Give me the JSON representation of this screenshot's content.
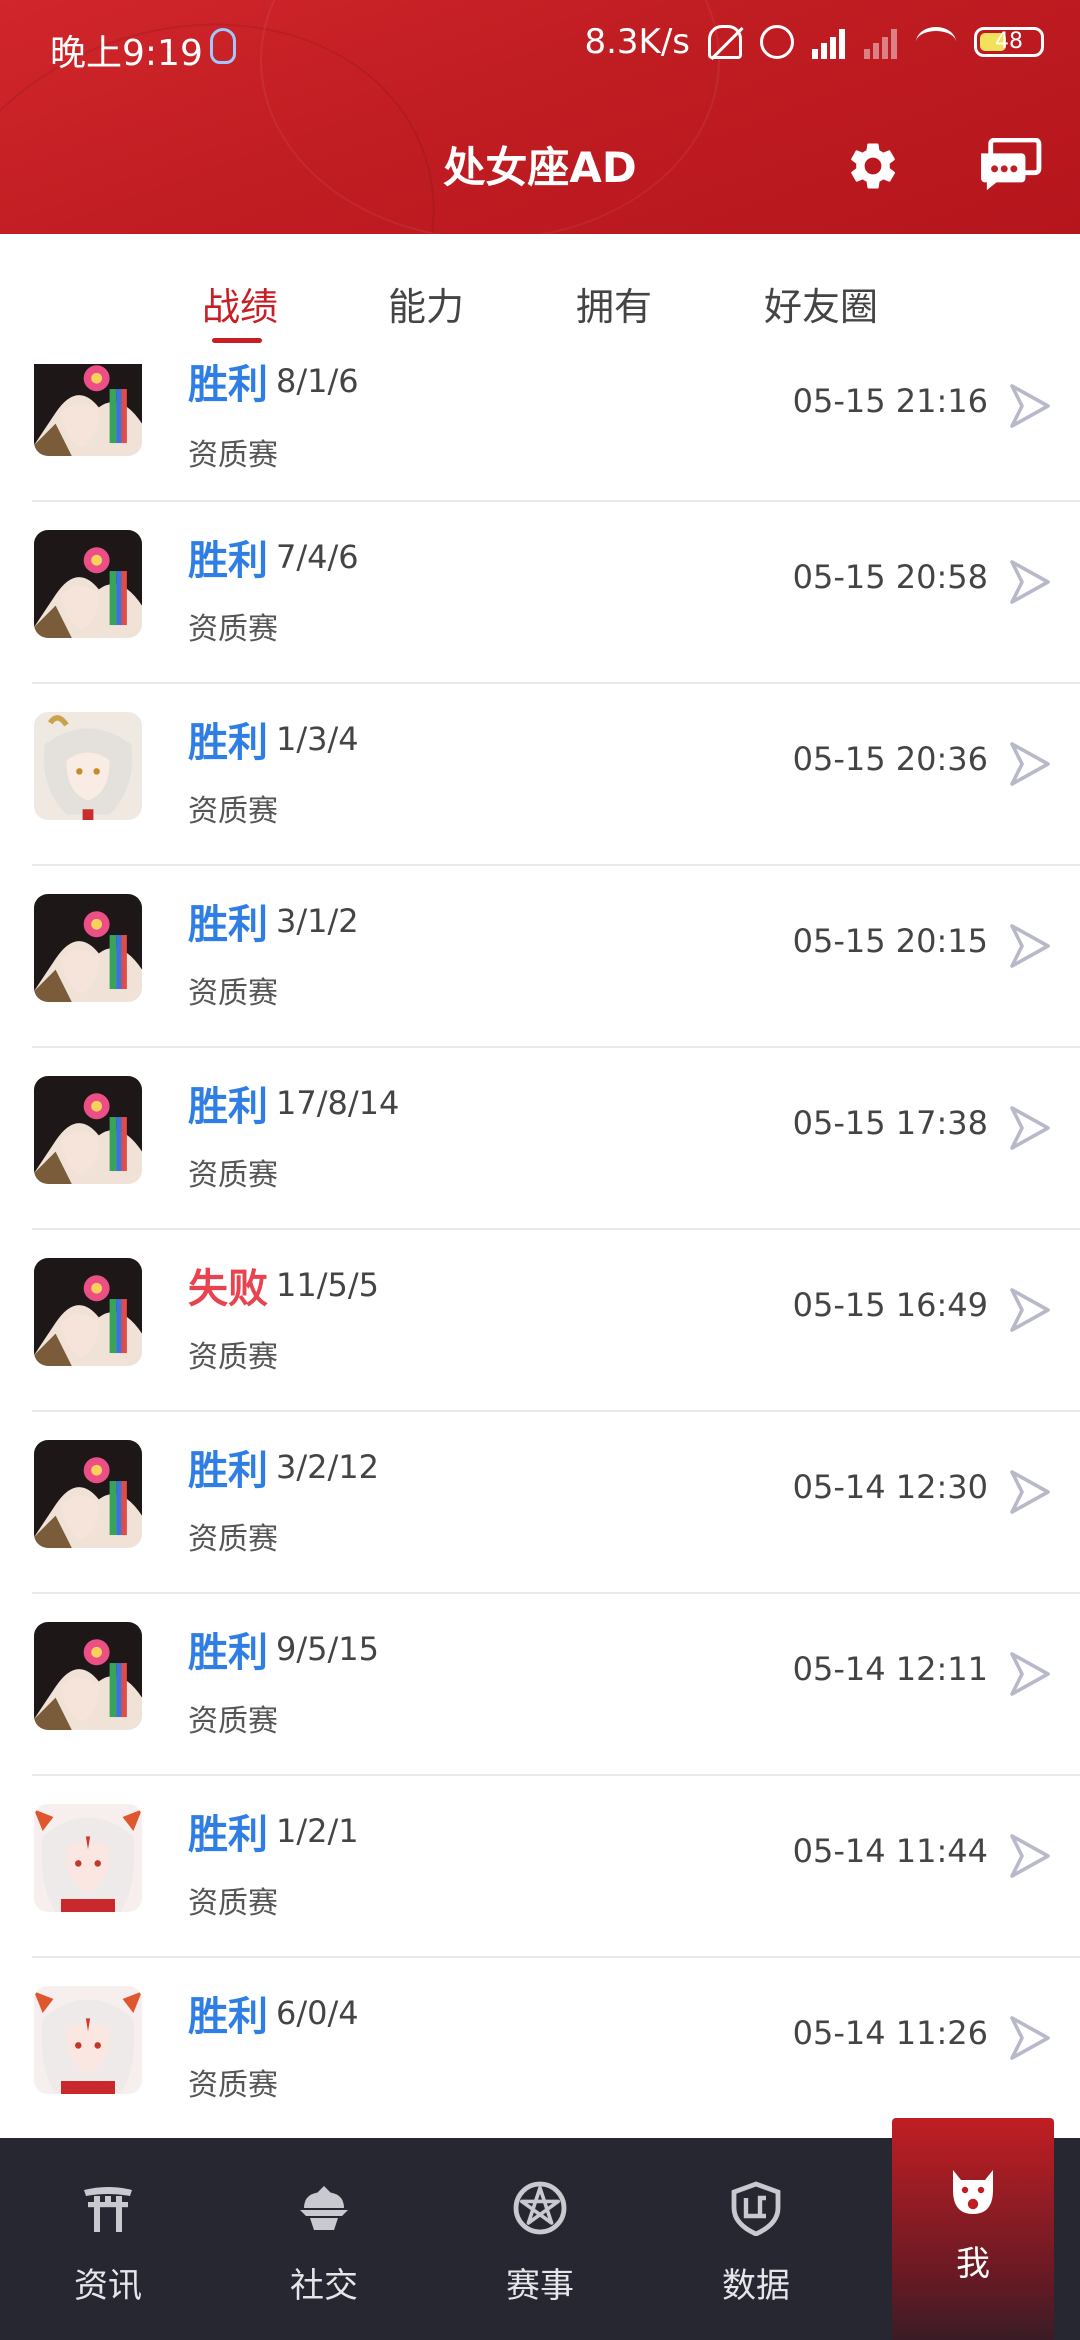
{
  "status_bar": {
    "time": "晚上9:19",
    "network_speed": "8.3K/s",
    "battery_level": "48"
  },
  "header": {
    "title": "处女座AD"
  },
  "tabs": [
    {
      "label": "战绩",
      "active": true
    },
    {
      "label": "能力",
      "active": false
    },
    {
      "label": "拥有",
      "active": false
    },
    {
      "label": "好友圈",
      "active": false
    }
  ],
  "matches": [
    {
      "result": "胜利",
      "kda": "8/1/6",
      "mode": "资质赛",
      "time": "05-15 21:16",
      "hero": "dark-hair-flower"
    },
    {
      "result": "胜利",
      "kda": "7/4/6",
      "mode": "资质赛",
      "time": "05-15 20:58",
      "hero": "dark-hair-flower"
    },
    {
      "result": "胜利",
      "kda": "1/3/4",
      "mode": "资质赛",
      "time": "05-15 20:36",
      "hero": "white-hair-horn"
    },
    {
      "result": "胜利",
      "kda": "3/1/2",
      "mode": "资质赛",
      "time": "05-15 20:15",
      "hero": "dark-hair-flower"
    },
    {
      "result": "胜利",
      "kda": "17/8/14",
      "mode": "资质赛",
      "time": "05-15 17:38",
      "hero": "dark-hair-flower"
    },
    {
      "result": "失败",
      "kda": "11/5/5",
      "mode": "资质赛",
      "time": "05-15 16:49",
      "hero": "dark-hair-flower"
    },
    {
      "result": "胜利",
      "kda": "3/2/12",
      "mode": "资质赛",
      "time": "05-14 12:30",
      "hero": "dark-hair-flower"
    },
    {
      "result": "胜利",
      "kda": "9/5/15",
      "mode": "资质赛",
      "time": "05-14 12:11",
      "hero": "dark-hair-flower"
    },
    {
      "result": "胜利",
      "kda": "1/2/1",
      "mode": "资质赛",
      "time": "05-14 11:44",
      "hero": "white-hair-red"
    },
    {
      "result": "胜利",
      "kda": "6/0/4",
      "mode": "资质赛",
      "time": "05-14 11:26",
      "hero": "white-hair-red"
    }
  ],
  "bottom_nav": [
    {
      "label": "资讯",
      "icon": "torii-gate-icon"
    },
    {
      "label": "社交",
      "icon": "helmet-icon"
    },
    {
      "label": "赛事",
      "icon": "pentagram-icon"
    },
    {
      "label": "数据",
      "icon": "shield-icon"
    },
    {
      "label": "我",
      "icon": "lucky-cat-icon",
      "active": true
    }
  ],
  "colors": {
    "brand_red": "#c71f25",
    "win_blue": "#2f7ee6",
    "loss_red": "#e8434f",
    "nav_bg": "#262730"
  }
}
